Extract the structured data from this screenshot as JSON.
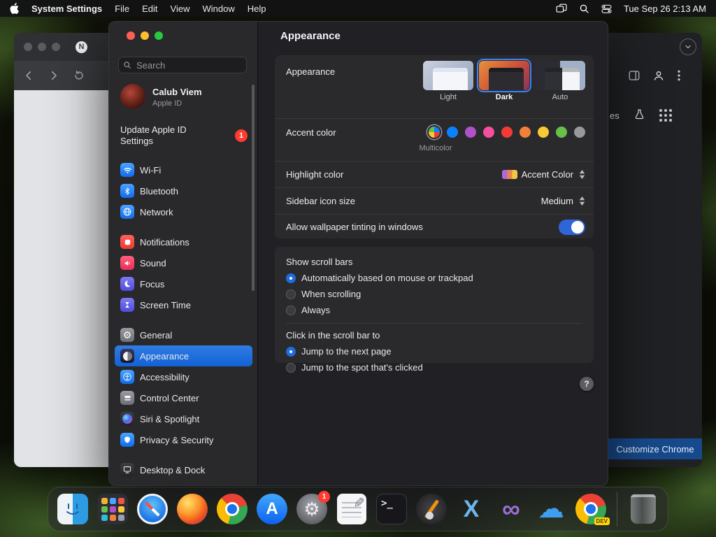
{
  "menu_bar": {
    "app_name": "System Settings",
    "menus": [
      "File",
      "Edit",
      "View",
      "Window",
      "Help"
    ],
    "clock": "Tue Sep 26 2:13 AM"
  },
  "browser": {
    "tab_favicon_text": "N",
    "shortcut_label": "es",
    "customize_button": "Customize Chrome"
  },
  "settings": {
    "sidebar": {
      "search_placeholder": "Search",
      "profile_name": "Calub Viem",
      "profile_subtitle": "Apple ID",
      "update_label": "Update Apple ID Settings",
      "update_badge": "1",
      "items": [
        {
          "label": "Wi-Fi"
        },
        {
          "label": "Bluetooth"
        },
        {
          "label": "Network"
        },
        {
          "label": "Notifications"
        },
        {
          "label": "Sound"
        },
        {
          "label": "Focus"
        },
        {
          "label": "Screen Time"
        },
        {
          "label": "General"
        },
        {
          "label": "Appearance",
          "selected": true
        },
        {
          "label": "Accessibility"
        },
        {
          "label": "Control Center"
        },
        {
          "label": "Siri & Spotlight"
        },
        {
          "label": "Privacy & Security"
        },
        {
          "label": "Desktop & Dock"
        }
      ]
    },
    "main": {
      "title": "Appearance",
      "appearance_label": "Appearance",
      "modes": [
        {
          "label": "Light"
        },
        {
          "label": "Dark",
          "selected": true
        },
        {
          "label": "Auto"
        }
      ],
      "accent_label": "Accent color",
      "accent_selected": "Multicolor",
      "accent_colors": [
        "multicolor",
        "#0a82ff",
        "#b051c9",
        "#f74f9e",
        "#f23b37",
        "#f2803b",
        "#f7c934",
        "#68c04a",
        "#98989d"
      ],
      "highlight_label": "Highlight color",
      "highlight_value": "Accent Color",
      "sidebar_size_label": "Sidebar icon size",
      "sidebar_size_value": "Medium",
      "tinting_label": "Allow wallpaper tinting in windows",
      "tinting_on": true,
      "scrollbars_title": "Show scroll bars",
      "scrollbars_options": [
        {
          "label": "Automatically based on mouse or trackpad",
          "selected": true
        },
        {
          "label": "When scrolling"
        },
        {
          "label": "Always"
        }
      ],
      "scrollclick_title": "Click in the scroll bar to",
      "scrollclick_options": [
        {
          "label": "Jump to the next page",
          "selected": true
        },
        {
          "label": "Jump to the spot that's clicked"
        }
      ],
      "help_label": "?"
    }
  },
  "dock": {
    "settings_badge": "1",
    "dev_badge": "DEV"
  }
}
